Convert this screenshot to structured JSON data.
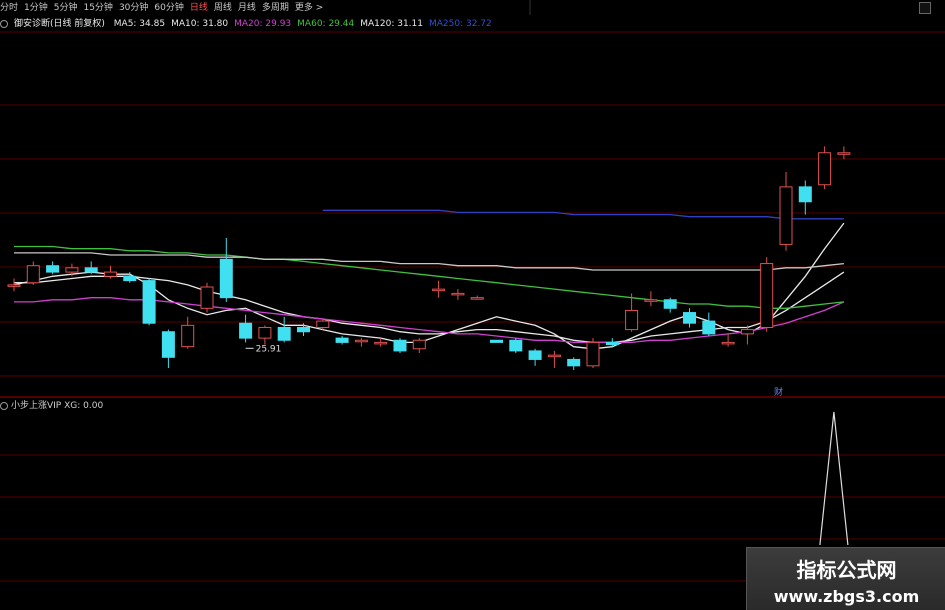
{
  "period_tabs": [
    {
      "label": "分时",
      "active": false
    },
    {
      "label": "1分钟",
      "active": false
    },
    {
      "label": "5分钟",
      "active": false
    },
    {
      "label": "15分钟",
      "active": false
    },
    {
      "label": "30分钟",
      "active": false
    },
    {
      "label": "60分钟",
      "active": false
    },
    {
      "label": "日线",
      "active": true
    },
    {
      "label": "周线",
      "active": false
    },
    {
      "label": "月线",
      "active": false
    },
    {
      "label": "多周期",
      "active": false
    },
    {
      "label": "更多 >",
      "active": false
    }
  ],
  "ma_bar": {
    "title": "御安诊断(日线 前复权)",
    "items": [
      {
        "label": "MA5: 34.85",
        "color": "#e8e8e8"
      },
      {
        "label": "MA10: 31.80",
        "color": "#e8e8e8"
      },
      {
        "label": "MA20: 29.93",
        "color": "#d040d0"
      },
      {
        "label": "MA60: 29.44",
        "color": "#40c040"
      },
      {
        "label": "MA120: 31.11",
        "color": "#e8e8e8"
      },
      {
        "label": "MA250: 32.72",
        "color": "#3050d0"
      }
    ]
  },
  "low_marker_label": "25.91",
  "cai_label": "财",
  "indicator_bar": {
    "label": "小步上涨VIP XG: 0.00"
  },
  "watermark": {
    "line1": "指标公式网",
    "line2": "www.zbgs3.com"
  },
  "colors": {
    "up": "#e05050",
    "down": "#40e0f0",
    "ma5": "#e8e8e8",
    "ma10": "#e8e8e8",
    "ma20": "#d040d0",
    "ma60": "#40c040",
    "ma120": "#c8c8c8",
    "ma250": "#3040c0",
    "grid": "#5a0000"
  },
  "chart_data": {
    "type": "candlestick",
    "low_label": 25.91,
    "candles": [
      {
        "o": 28.7,
        "c": 28.7,
        "h": 29.0,
        "l": 28.4,
        "dir": "up"
      },
      {
        "o": 28.8,
        "c": 29.6,
        "h": 29.8,
        "l": 28.7,
        "dir": "up"
      },
      {
        "o": 29.6,
        "c": 29.3,
        "h": 29.8,
        "l": 29.2,
        "dir": "down"
      },
      {
        "o": 29.3,
        "c": 29.5,
        "h": 29.7,
        "l": 29.1,
        "dir": "up"
      },
      {
        "o": 29.5,
        "c": 29.3,
        "h": 29.8,
        "l": 29.2,
        "dir": "down"
      },
      {
        "o": 29.3,
        "c": 29.1,
        "h": 29.6,
        "l": 29.0,
        "dir": "up"
      },
      {
        "o": 29.1,
        "c": 28.9,
        "h": 29.3,
        "l": 28.8,
        "dir": "down"
      },
      {
        "o": 28.9,
        "c": 26.9,
        "h": 29.0,
        "l": 26.8,
        "dir": "down"
      },
      {
        "o": 26.5,
        "c": 25.3,
        "h": 26.6,
        "l": 24.8,
        "dir": "down"
      },
      {
        "o": 25.8,
        "c": 26.8,
        "h": 27.2,
        "l": 25.7,
        "dir": "up"
      },
      {
        "o": 27.6,
        "c": 28.6,
        "h": 28.8,
        "l": 27.4,
        "dir": "up"
      },
      {
        "o": 28.1,
        "c": 29.9,
        "h": 30.9,
        "l": 27.9,
        "dir": "down"
      },
      {
        "o": 26.9,
        "c": 26.2,
        "h": 27.3,
        "l": 26.0,
        "dir": "down"
      },
      {
        "o": 26.2,
        "c": 26.7,
        "h": 26.8,
        "l": 25.9,
        "dir": "up"
      },
      {
        "o": 26.7,
        "c": 26.1,
        "h": 27.2,
        "l": 26.0,
        "dir": "down"
      },
      {
        "o": 26.7,
        "c": 26.5,
        "h": 26.9,
        "l": 26.3,
        "dir": "down"
      },
      {
        "o": 26.7,
        "c": 27.0,
        "h": 27.1,
        "l": 26.6,
        "dir": "up"
      },
      {
        "o": 26.2,
        "c": 26.0,
        "h": 26.3,
        "l": 25.9,
        "dir": "down"
      },
      {
        "o": 26.1,
        "c": 26.1,
        "h": 26.2,
        "l": 25.8,
        "dir": "up"
      },
      {
        "o": 26.0,
        "c": 26.0,
        "h": 26.2,
        "l": 25.8,
        "dir": "up"
      },
      {
        "o": 26.1,
        "c": 25.6,
        "h": 26.2,
        "l": 25.5,
        "dir": "down"
      },
      {
        "o": 25.7,
        "c": 26.1,
        "h": 26.2,
        "l": 25.5,
        "dir": "up"
      },
      {
        "o": 28.5,
        "c": 28.5,
        "h": 28.9,
        "l": 28.1,
        "dir": "up"
      },
      {
        "o": 28.3,
        "c": 28.3,
        "h": 28.5,
        "l": 28.0,
        "dir": "up"
      },
      {
        "o": 28.1,
        "c": 28.1,
        "h": 28.2,
        "l": 28.0,
        "dir": "up"
      },
      {
        "o": 26.1,
        "c": 26.0,
        "h": 26.1,
        "l": 26.0,
        "dir": "down"
      },
      {
        "o": 26.1,
        "c": 25.6,
        "h": 26.2,
        "l": 25.5,
        "dir": "down"
      },
      {
        "o": 25.6,
        "c": 25.2,
        "h": 25.7,
        "l": 24.9,
        "dir": "down"
      },
      {
        "o": 25.4,
        "c": 25.4,
        "h": 25.6,
        "l": 24.8,
        "dir": "up"
      },
      {
        "o": 25.2,
        "c": 24.9,
        "h": 25.3,
        "l": 24.7,
        "dir": "down"
      },
      {
        "o": 24.9,
        "c": 26.0,
        "h": 26.2,
        "l": 24.8,
        "dir": "up"
      },
      {
        "o": 26.0,
        "c": 25.9,
        "h": 26.2,
        "l": 25.8,
        "dir": "down"
      },
      {
        "o": 26.6,
        "c": 27.5,
        "h": 28.3,
        "l": 26.5,
        "dir": "up"
      },
      {
        "o": 28.0,
        "c": 28.0,
        "h": 28.4,
        "l": 27.7,
        "dir": "up"
      },
      {
        "o": 28.0,
        "c": 27.6,
        "h": 28.1,
        "l": 27.4,
        "dir": "down"
      },
      {
        "o": 27.4,
        "c": 26.9,
        "h": 27.6,
        "l": 26.7,
        "dir": "down"
      },
      {
        "o": 27.0,
        "c": 26.4,
        "h": 27.4,
        "l": 26.3,
        "dir": "down"
      },
      {
        "o": 26.0,
        "c": 26.0,
        "h": 26.4,
        "l": 25.8,
        "dir": "up"
      },
      {
        "o": 26.4,
        "c": 26.6,
        "h": 26.8,
        "l": 25.9,
        "dir": "up"
      },
      {
        "o": 26.7,
        "c": 29.7,
        "h": 30.0,
        "l": 26.5,
        "dir": "up"
      },
      {
        "o": 30.6,
        "c": 33.3,
        "h": 34.0,
        "l": 30.3,
        "dir": "up"
      },
      {
        "o": 33.3,
        "c": 32.6,
        "h": 33.6,
        "l": 32.0,
        "dir": "down"
      },
      {
        "o": 33.4,
        "c": 34.9,
        "h": 35.2,
        "l": 33.2,
        "dir": "up"
      },
      {
        "o": 34.9,
        "c": 34.9,
        "h": 35.2,
        "l": 34.6,
        "dir": "up"
      }
    ],
    "series": [
      {
        "name": "MA5",
        "values": [
          28.7,
          28.9,
          29.1,
          29.2,
          29.3,
          29.2,
          29.2,
          28.7,
          28.0,
          27.6,
          27.3,
          27.5,
          27.6,
          27.2,
          26.8,
          26.8,
          26.6,
          26.4,
          26.3,
          26.2,
          26.0,
          26.0,
          26.3,
          26.6,
          26.9,
          27.2,
          27.0,
          26.8,
          26.4,
          25.8,
          25.7,
          25.8,
          26.2,
          26.6,
          27.0,
          27.3,
          27.0,
          26.6,
          26.4,
          26.9,
          28.0,
          29.1,
          30.4,
          31.6
        ]
      },
      {
        "name": "MA10",
        "values": [
          28.8,
          28.8,
          28.9,
          29.0,
          29.1,
          29.1,
          29.1,
          29.0,
          28.9,
          28.7,
          28.4,
          28.2,
          28.0,
          27.7,
          27.4,
          27.2,
          27.1,
          26.9,
          26.8,
          26.7,
          26.5,
          26.4,
          26.4,
          26.5,
          26.6,
          26.6,
          26.5,
          26.4,
          26.3,
          26.1,
          26.0,
          26.0,
          26.1,
          26.3,
          26.4,
          26.5,
          26.6,
          26.7,
          26.7,
          27.0,
          27.5,
          28.1,
          28.7,
          29.3
        ]
      },
      {
        "name": "MA20",
        "values": [
          27.9,
          27.9,
          28.0,
          28.0,
          28.1,
          28.1,
          28.0,
          28.0,
          27.9,
          27.8,
          27.7,
          27.6,
          27.5,
          27.4,
          27.3,
          27.2,
          27.1,
          27.0,
          26.9,
          26.8,
          26.7,
          26.6,
          26.5,
          26.4,
          26.4,
          26.3,
          26.2,
          26.1,
          26.1,
          26.0,
          26.0,
          26.0,
          26.0,
          26.1,
          26.1,
          26.2,
          26.3,
          26.4,
          26.5,
          26.7,
          26.9,
          27.2,
          27.5,
          27.9
        ]
      },
      {
        "name": "MA60",
        "values": [
          30.5,
          30.5,
          30.5,
          30.4,
          30.4,
          30.4,
          30.3,
          30.3,
          30.2,
          30.2,
          30.1,
          30.1,
          30.0,
          29.9,
          29.9,
          29.8,
          29.7,
          29.6,
          29.5,
          29.4,
          29.3,
          29.2,
          29.1,
          29.0,
          28.9,
          28.8,
          28.7,
          28.6,
          28.5,
          28.4,
          28.3,
          28.2,
          28.1,
          28.0,
          27.9,
          27.8,
          27.8,
          27.7,
          27.7,
          27.6,
          27.6,
          27.7,
          27.8,
          27.9
        ]
      },
      {
        "name": "MA120",
        "values": [
          30.2,
          30.2,
          30.2,
          30.2,
          30.2,
          30.1,
          30.1,
          30.1,
          30.1,
          30.1,
          30.0,
          30.0,
          30.0,
          29.9,
          29.9,
          29.9,
          29.9,
          29.8,
          29.8,
          29.8,
          29.7,
          29.7,
          29.7,
          29.6,
          29.6,
          29.6,
          29.5,
          29.5,
          29.5,
          29.5,
          29.4,
          29.4,
          29.4,
          29.4,
          29.4,
          29.4,
          29.4,
          29.4,
          29.4,
          29.4,
          29.5,
          29.5,
          29.6,
          29.7
        ]
      },
      {
        "name": "MA250",
        "values": [
          null,
          null,
          null,
          null,
          null,
          null,
          null,
          null,
          null,
          null,
          null,
          null,
          null,
          null,
          null,
          null,
          32.2,
          32.2,
          32.2,
          32.2,
          32.2,
          32.2,
          32.2,
          32.1,
          32.1,
          32.1,
          32.1,
          32.1,
          32.1,
          32.0,
          32.0,
          32.0,
          32.0,
          32.0,
          32.0,
          31.9,
          31.9,
          31.9,
          31.9,
          31.9,
          31.8,
          31.8,
          31.8,
          31.8
        ]
      }
    ],
    "indicator": {
      "name": "小步上涨VIP XG",
      "values": [
        0,
        0,
        0,
        0,
        0,
        0,
        0,
        0,
        0,
        0,
        0,
        0,
        0,
        0,
        0,
        0,
        0,
        0,
        0,
        0,
        0,
        0,
        0,
        0,
        0,
        0,
        0,
        0,
        0,
        0,
        0,
        0,
        0,
        0,
        0,
        0,
        0,
        0,
        0,
        0,
        0,
        0,
        0,
        1
      ]
    }
  }
}
